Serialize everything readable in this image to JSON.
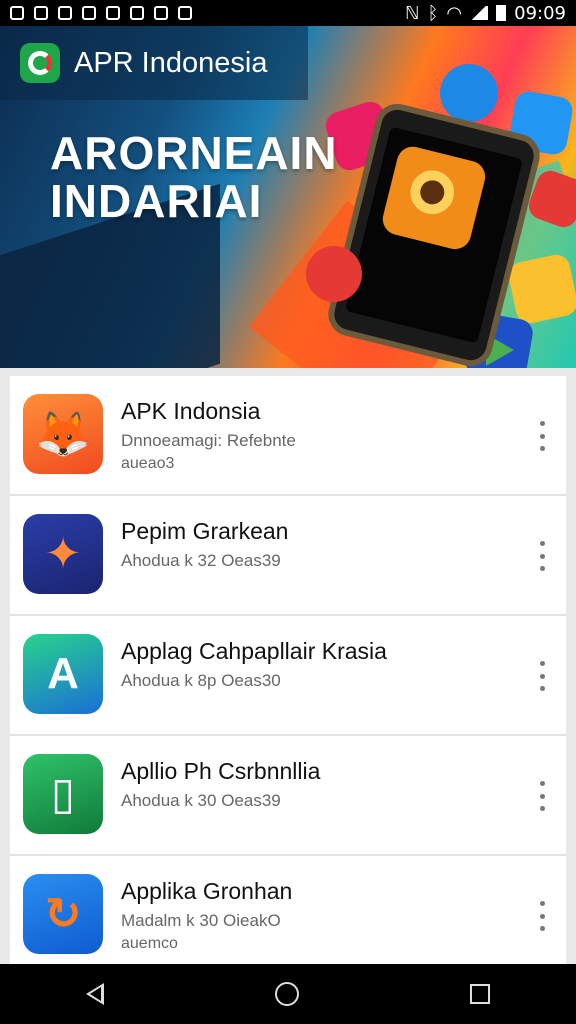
{
  "status_bar": {
    "time": "09:09"
  },
  "banner": {
    "app_title": "APR Indonesia",
    "headline_line1": "ARORNEAIN",
    "headline_line2": "INDARIAI"
  },
  "apps": [
    {
      "name": "APK Indonsia",
      "line1": "Dnnoeamagi: Refebnte",
      "line2": "aueao3"
    },
    {
      "name": "Pepim Grarkean",
      "line1": "Ahodua k 32 Oeas39",
      "line2": ""
    },
    {
      "name": "Applag Cahpapllair Krasia",
      "line1": "Ahodua k 8p Oeas30",
      "line2": ""
    },
    {
      "name": "Apllio Ph Csrbnnllia",
      "line1": "Ahodua k 30 Oeas39",
      "line2": ""
    },
    {
      "name": "Applika Gronhan",
      "line1": "Madalm k 30 OieakO",
      "line2": "auemco"
    }
  ],
  "icons": {
    "app0": "fox-mascot-icon",
    "app1": "colorful-swirl-icon",
    "app2": "letter-a-icon",
    "app3": "phone-character-icon",
    "app4": "refresh-swirl-icon"
  },
  "colors": {
    "status_bar": "#000000",
    "nav_bar": "#000000",
    "list_background": "#ffffff",
    "page_background": "#e9e9e9"
  }
}
